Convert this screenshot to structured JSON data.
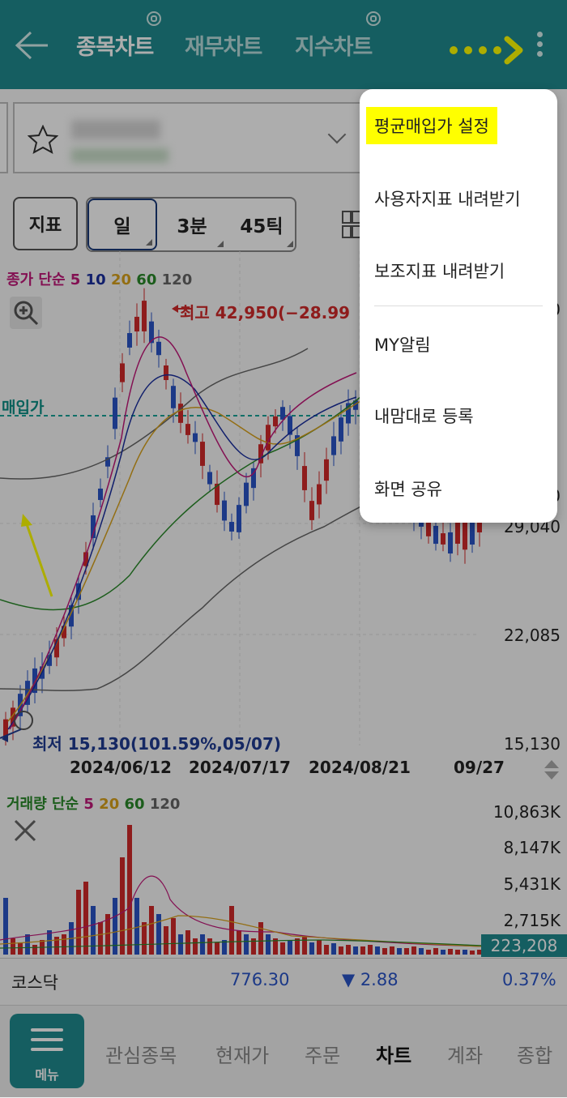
{
  "header": {
    "tabs": [
      {
        "label": "종목차트",
        "active": true
      },
      {
        "label": "재무차트",
        "active": false
      },
      {
        "label": "지수차트",
        "active": false
      }
    ]
  },
  "toolbar": {
    "indicator_label": "지표",
    "periods": [
      {
        "label": "일",
        "selected": true
      },
      {
        "label": "3분",
        "selected": false
      },
      {
        "label": "45틱",
        "selected": false
      }
    ]
  },
  "price_legend": {
    "prefix": "종가 단순",
    "periods": [
      {
        "label": "5",
        "color": "#c2187a"
      },
      {
        "label": "10",
        "color": "#1a2fa0"
      },
      {
        "label": "20",
        "color": "#d9a21c"
      },
      {
        "label": "60",
        "color": "#2a8a2a"
      },
      {
        "label": "120",
        "color": "#666666"
      }
    ]
  },
  "chart": {
    "high_label": "최고 42,950(−28.99",
    "low_label": "최저 15,130(101.59%,05/07)",
    "avg_label": "매입가",
    "y_labels": [
      "29,040",
      "22,085",
      "15,130"
    ],
    "y_partial_top": "0",
    "y_partial_avg": "2",
    "y_partial_mid": "0",
    "x_labels": [
      "2024/06/12",
      "2024/07/17",
      "2024/08/21",
      "09/27"
    ]
  },
  "volume": {
    "legend_prefix": "거래량 단순",
    "periods": [
      {
        "label": "5",
        "color": "#c2187a"
      },
      {
        "label": "20",
        "color": "#d9a21c"
      },
      {
        "label": "60",
        "color": "#2a8a2a"
      },
      {
        "label": "120",
        "color": "#666666"
      }
    ],
    "y_labels": [
      "10,863K",
      "8,147K",
      "5,431K",
      "2,715K"
    ],
    "current": "223,208"
  },
  "index_row": {
    "name": "코스닥",
    "value": "776.30",
    "change": "▼ 2.88",
    "pct": "0.37%"
  },
  "bottom_nav": {
    "menu_label": "메뉴",
    "items": [
      {
        "label": "관심종목",
        "active": false
      },
      {
        "label": "현재가",
        "active": false
      },
      {
        "label": "주문",
        "active": false
      },
      {
        "label": "차트",
        "active": true
      },
      {
        "label": "계좌",
        "active": false
      },
      {
        "label": "종합",
        "active": false
      }
    ]
  },
  "menu": {
    "items": [
      {
        "label": "평균매입가 설정",
        "highlighted": true
      },
      {
        "label": "사용자지표 내려받기"
      },
      {
        "label": "보조지표 내려받기"
      },
      {
        "label": "MY알림"
      },
      {
        "label": "내맘대로 등록"
      },
      {
        "label": "화면 공유"
      }
    ]
  },
  "colors": {
    "header_bg": "#1f8b8f",
    "up_candle": "#d22a2a",
    "down_candle": "#2a55c8",
    "highlight": "#ffff00",
    "arrow": "#ffff00"
  }
}
